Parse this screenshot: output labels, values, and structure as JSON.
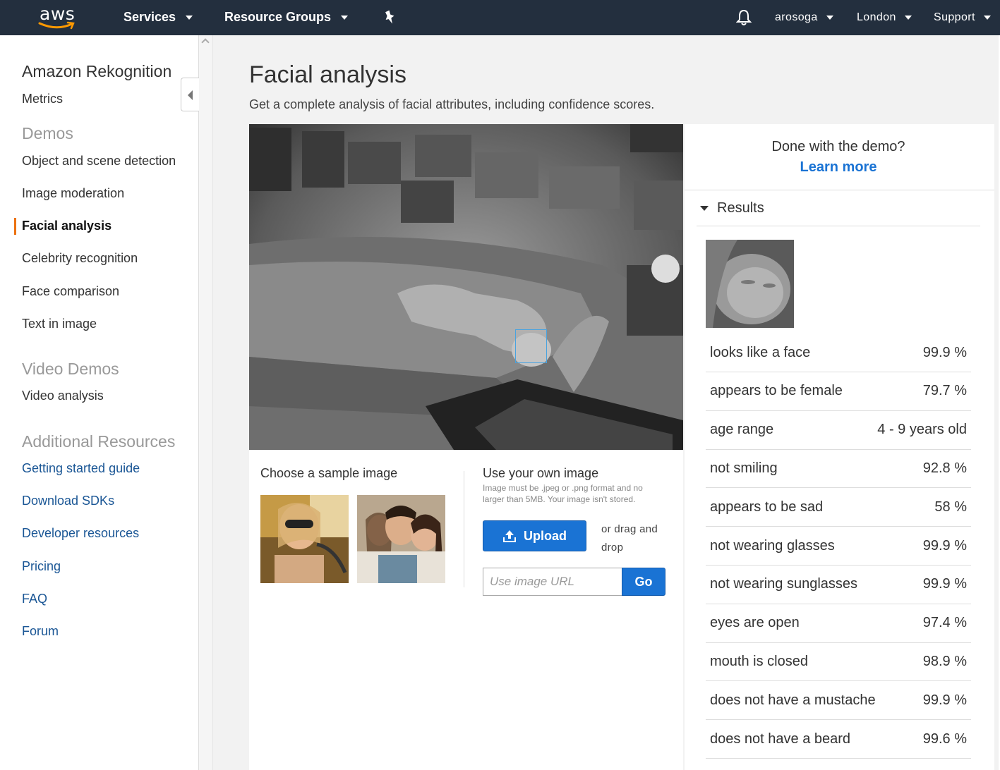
{
  "nav": {
    "logo_text": "aws",
    "services": "Services",
    "resource_groups": "Resource Groups",
    "user": "arosoga",
    "region": "London",
    "support": "Support"
  },
  "sidebar": {
    "title": "Amazon Rekognition",
    "metrics": "Metrics",
    "demos_heading": "Demos",
    "demos": [
      "Object and scene detection",
      "Image moderation",
      "Facial analysis",
      "Celebrity recognition",
      "Face comparison",
      "Text in image"
    ],
    "video_heading": "Video Demos",
    "video_items": [
      "Video analysis"
    ],
    "resources_heading": "Additional Resources",
    "resources": [
      "Getting started guide",
      "Download SDKs",
      "Developer resources",
      "Pricing",
      "FAQ",
      "Forum"
    ]
  },
  "main": {
    "title": "Facial analysis",
    "subtitle": "Get a complete analysis of facial attributes, including confidence scores.",
    "sample_title": "Choose a sample image",
    "own_title": "Use your own image",
    "own_note": "Image must be .jpeg or .png format and no larger than 5MB. Your image isn't stored.",
    "upload_label": "Upload",
    "drag_text": "or drag and drop",
    "url_placeholder": "Use image URL",
    "go_label": "Go"
  },
  "results": {
    "done_text": "Done with the demo?",
    "learn_more": "Learn more",
    "toggle_label": "Results",
    "attributes": [
      {
        "label": "looks like a face",
        "value": "99.9 %"
      },
      {
        "label": "appears to be female",
        "value": "79.7 %"
      },
      {
        "label": "age range",
        "value": "4 - 9 years old"
      },
      {
        "label": "not smiling",
        "value": "92.8 %"
      },
      {
        "label": "appears to be sad",
        "value": "58 %"
      },
      {
        "label": "not wearing glasses",
        "value": "99.9 %"
      },
      {
        "label": "not wearing sunglasses",
        "value": "99.9 %"
      },
      {
        "label": "eyes are open",
        "value": "97.4 %"
      },
      {
        "label": "mouth is closed",
        "value": "98.9 %"
      },
      {
        "label": "does not have a mustache",
        "value": "99.9 %"
      },
      {
        "label": "does not have a beard",
        "value": "99.6 %"
      }
    ]
  },
  "colors": {
    "nav_bg": "#232f3e",
    "accent_orange": "#ec7211",
    "link_blue": "#1a5695",
    "button_blue": "#1a73d4"
  },
  "icons": [
    "bell-icon",
    "pin-icon",
    "upload-icon",
    "collapse-arrow-icon",
    "caret-down-icon"
  ]
}
